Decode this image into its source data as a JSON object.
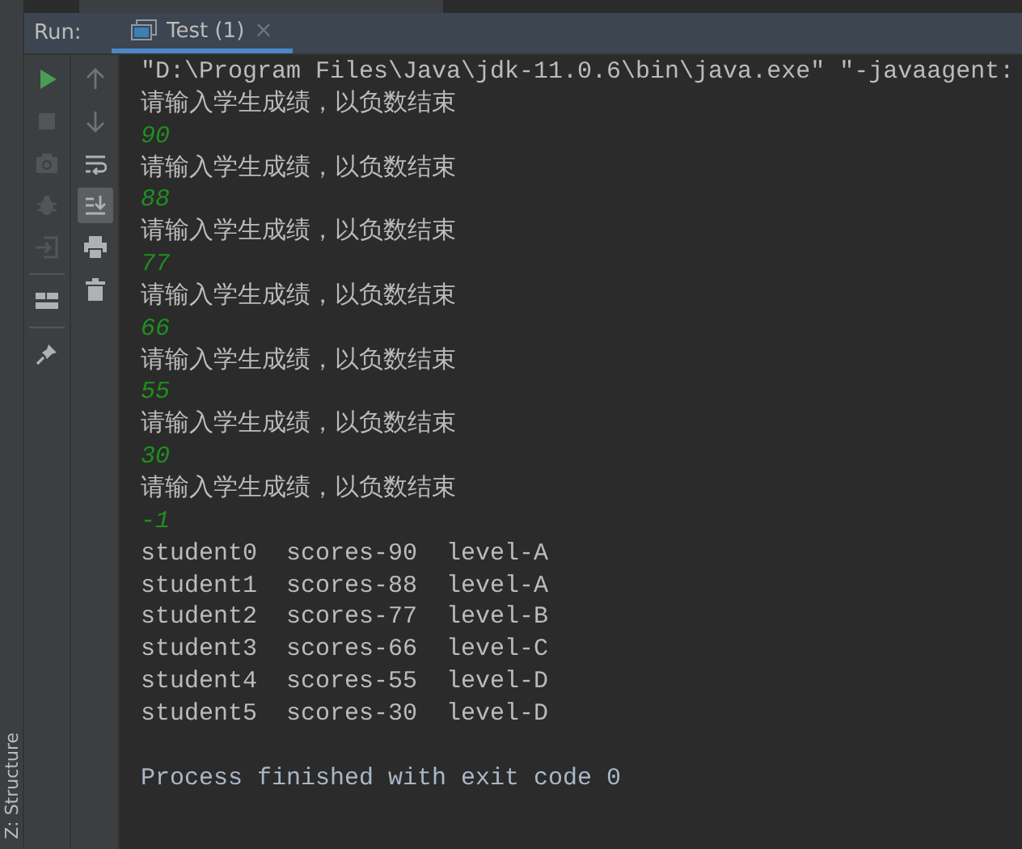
{
  "side_tab": {
    "label": "Z: Structure"
  },
  "run_panel": {
    "label": "Run:",
    "tabs": [
      {
        "label": "Test (1)",
        "selected": true,
        "close": "×"
      }
    ]
  },
  "left_toolbar": [
    {
      "disabled": false
    },
    {
      "disabled": true
    },
    {
      "disabled": true
    },
    {
      "disabled": true
    },
    {
      "disabled": true
    },
    {
      "disabled": false
    },
    {
      "disabled": false
    }
  ],
  "right_toolbar": [
    {
      "disabled": true,
      "selected": false
    },
    {
      "disabled": true,
      "selected": false
    },
    {
      "disabled": false,
      "selected": false
    },
    {
      "disabled": false,
      "selected": true
    },
    {
      "disabled": false,
      "selected": false
    },
    {
      "disabled": false,
      "selected": false
    }
  ],
  "console": [
    {
      "kind": "command",
      "text": "\"D:\\Program Files\\Java\\jdk-11.0.6\\bin\\java.exe\" \"-javaagent:"
    },
    {
      "kind": "output",
      "text": "请输入学生成绩，以负数结束"
    },
    {
      "kind": "input",
      "text": "90"
    },
    {
      "kind": "output",
      "text": "请输入学生成绩，以负数结束"
    },
    {
      "kind": "input",
      "text": "88"
    },
    {
      "kind": "output",
      "text": "请输入学生成绩，以负数结束"
    },
    {
      "kind": "input",
      "text": "77"
    },
    {
      "kind": "output",
      "text": "请输入学生成绩，以负数结束"
    },
    {
      "kind": "input",
      "text": "66"
    },
    {
      "kind": "output",
      "text": "请输入学生成绩，以负数结束"
    },
    {
      "kind": "input",
      "text": "55"
    },
    {
      "kind": "output",
      "text": "请输入学生成绩，以负数结束"
    },
    {
      "kind": "input",
      "text": "30"
    },
    {
      "kind": "output",
      "text": "请输入学生成绩，以负数结束"
    },
    {
      "kind": "input",
      "text": "-1"
    },
    {
      "kind": "output",
      "text": "student0  scores-90  level-A"
    },
    {
      "kind": "output",
      "text": "student1  scores-88  level-A"
    },
    {
      "kind": "output",
      "text": "student2  scores-77  level-B"
    },
    {
      "kind": "output",
      "text": "student3  scores-66  level-C"
    },
    {
      "kind": "output",
      "text": "student4  scores-55  level-D"
    },
    {
      "kind": "output",
      "text": "student5  scores-30  level-D"
    },
    {
      "kind": "blank"
    },
    {
      "kind": "system",
      "text": "Process finished with exit code 0"
    }
  ]
}
